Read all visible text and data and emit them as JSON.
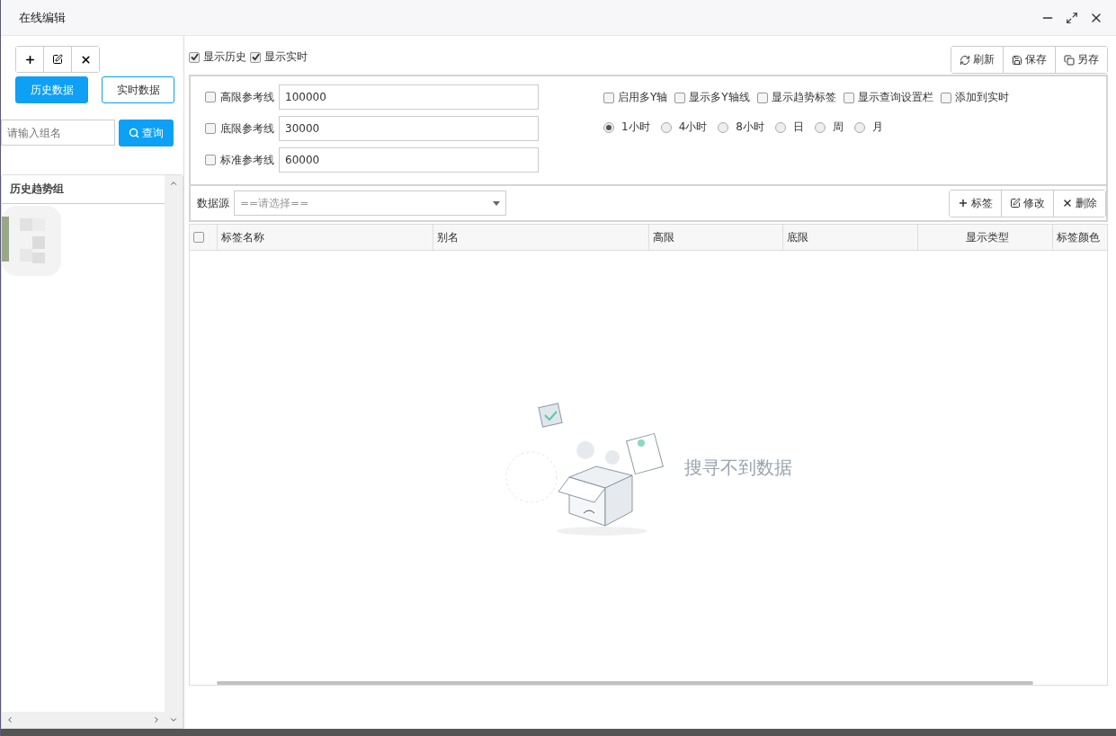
{
  "window": {
    "title": "在线编辑"
  },
  "left": {
    "tools": [
      {
        "kind": "add"
      },
      {
        "kind": "edit"
      },
      {
        "kind": "delete"
      }
    ],
    "modes": [
      {
        "label": "历史数据",
        "selected": true
      },
      {
        "label": "实时数据",
        "selected": false
      }
    ],
    "search": {
      "placeholder": "请输入组名",
      "button": "查询"
    },
    "tree": {
      "title": "历史趋势组"
    }
  },
  "top": {
    "toggles": [
      {
        "label": "显示历史",
        "checked": true
      },
      {
        "label": "显示实时",
        "checked": true
      }
    ],
    "actions": [
      {
        "kind": "refresh",
        "label": "刷新"
      },
      {
        "kind": "save",
        "label": "保存"
      },
      {
        "kind": "copy",
        "label": "另存"
      }
    ]
  },
  "settings": {
    "reference_lines": [
      {
        "label": "高限参考线",
        "checked": false,
        "value": "100000"
      },
      {
        "label": "底限参考线",
        "checked": false,
        "value": "30000"
      },
      {
        "label": "标准参考线",
        "checked": false,
        "value": "60000"
      }
    ],
    "options": [
      {
        "label": "启用多Y轴",
        "checked": false
      },
      {
        "label": "显示多Y轴线",
        "checked": false
      },
      {
        "label": "显示趋势标签",
        "checked": false
      },
      {
        "label": "显示查询设置栏",
        "checked": false
      },
      {
        "label": "添加到实时",
        "checked": false
      }
    ],
    "ranges": [
      {
        "label": "1小时",
        "selected": true
      },
      {
        "label": "4小时",
        "selected": false
      },
      {
        "label": "8小时",
        "selected": false
      },
      {
        "label": "日",
        "selected": false
      },
      {
        "label": "周",
        "selected": false
      },
      {
        "label": "月",
        "selected": false
      }
    ]
  },
  "source": {
    "label": "数据源",
    "placeholder": "==请选择==",
    "actions": [
      {
        "kind": "add",
        "label": "标签"
      },
      {
        "kind": "edit",
        "label": "修改"
      },
      {
        "kind": "delete",
        "label": "删除"
      }
    ]
  },
  "table": {
    "select_all": false,
    "columns": [
      "标签名称",
      "别名",
      "高限",
      "底限",
      "显示类型",
      "标签颜色"
    ],
    "empty_text": "搜寻不到数据"
  }
}
